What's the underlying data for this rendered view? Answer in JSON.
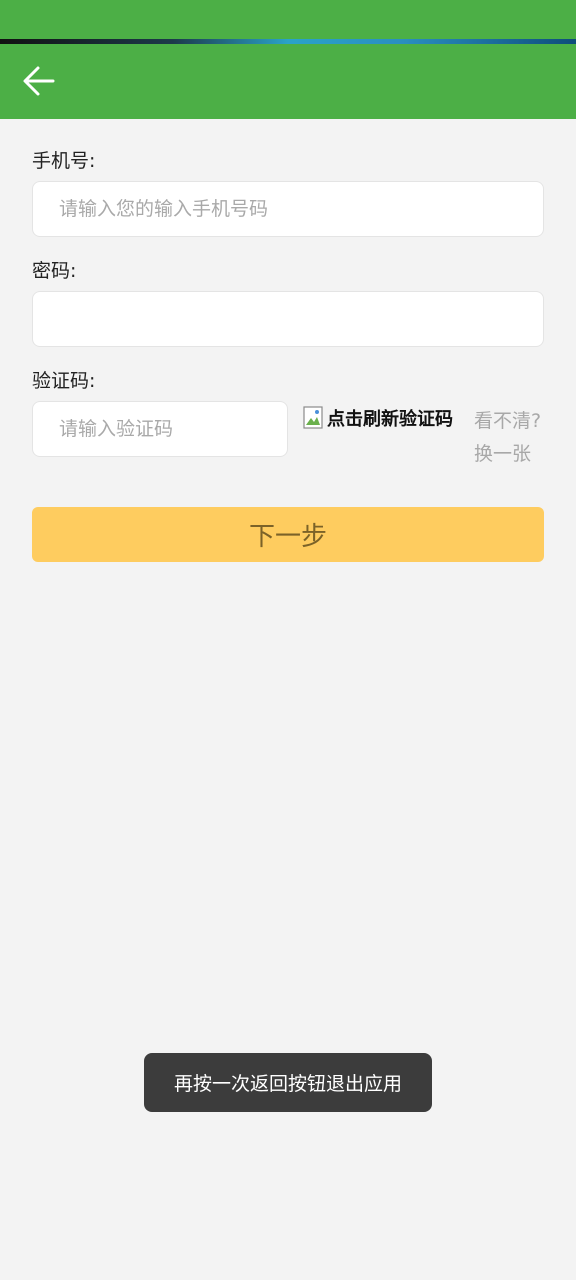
{
  "colors": {
    "primary": "#4caf46",
    "button": "#fecc5f",
    "button_text": "#7b6228",
    "background": "#f3f3f3",
    "toast_bg": "#3c3c3c"
  },
  "header": {
    "back_icon": "arrow-left-icon"
  },
  "form": {
    "phone_label": "手机号:",
    "phone_placeholder": "请输入您的输入手机号码",
    "phone_value": "",
    "password_label": "密码:",
    "password_value": "",
    "captcha_label": "验证码:",
    "captcha_placeholder": "请输入验证码",
    "captcha_value": "",
    "captcha_image_alt": "点击刷新验证码",
    "refresh_line1": "看不清?",
    "refresh_line2": "换一张",
    "next_label": "下一步"
  },
  "toast": {
    "message": "再按一次返回按钮退出应用"
  }
}
